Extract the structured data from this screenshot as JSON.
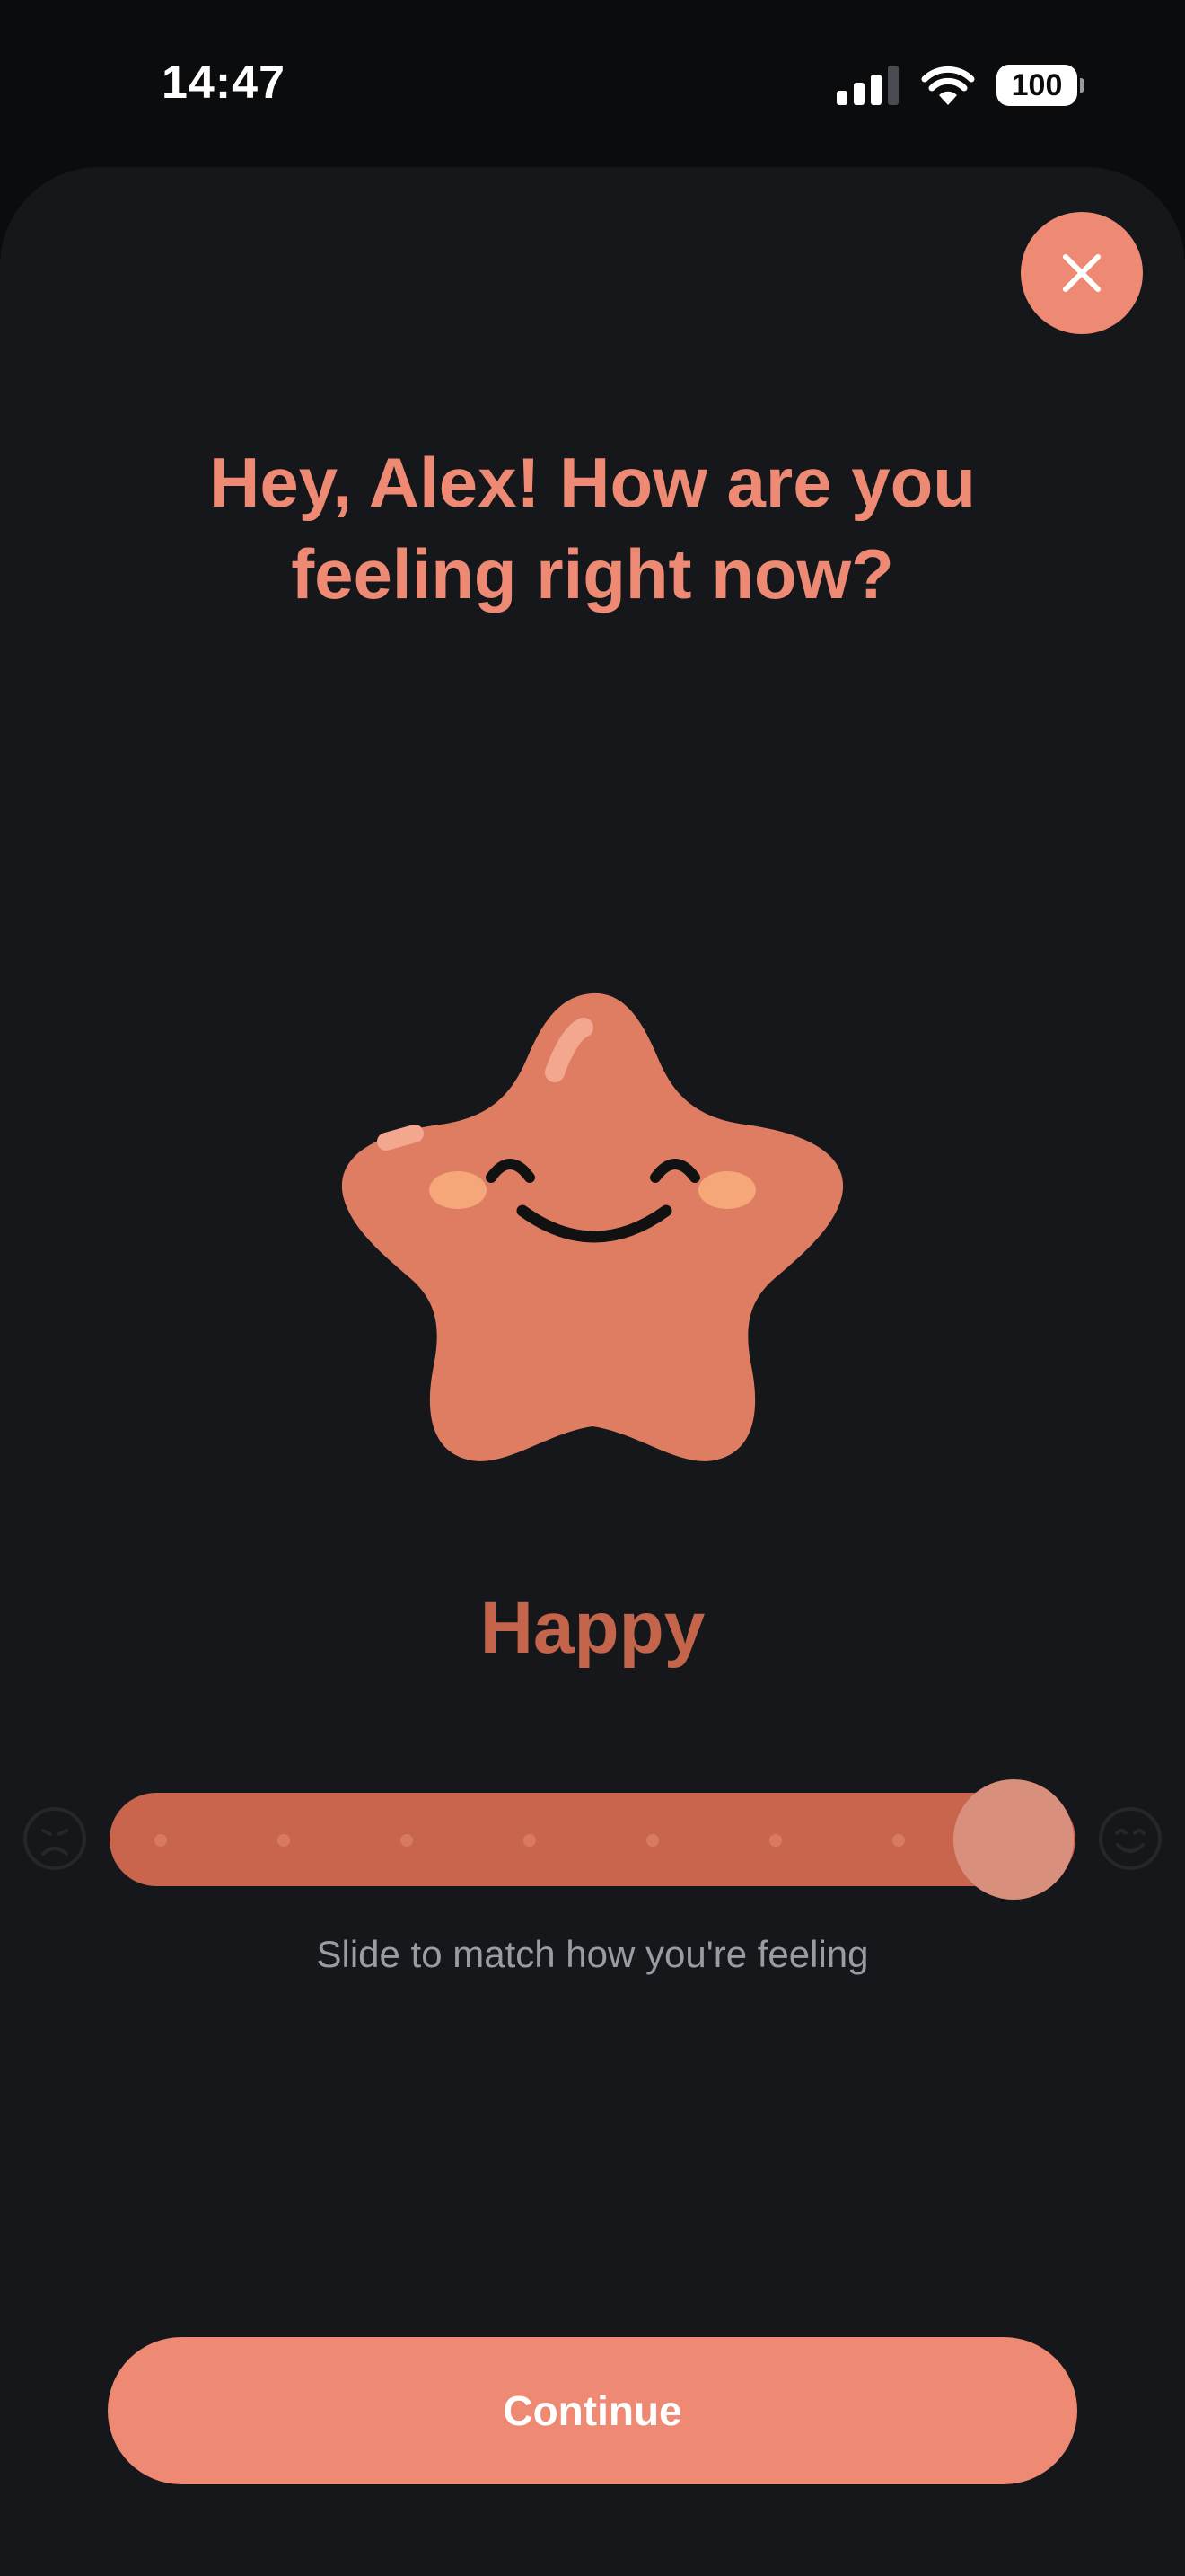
{
  "status_bar": {
    "time": "14:47",
    "battery": "100",
    "icons": [
      "cellular-signal-icon",
      "wifi-icon",
      "battery-icon"
    ]
  },
  "header": {
    "close_icon": "close-icon",
    "title": "Hey, Alex! How are you feeling right now?"
  },
  "mood": {
    "mascot": "smiling-star",
    "label": "Happy",
    "slider": {
      "value": 1.0,
      "steps": 8,
      "min_icon": "sad-face-icon",
      "max_icon": "smiley-face-icon"
    },
    "hint": "Slide to match how you're feeling"
  },
  "footer": {
    "continue_label": "Continue"
  },
  "colors": {
    "accent": "#ee8a73",
    "slider_track": "#c9654d",
    "mood_label": "#c4644b",
    "sheet_bg": "#16171b",
    "page_bg": "#0b0c0e",
    "hint_text": "#9a9ca3"
  }
}
